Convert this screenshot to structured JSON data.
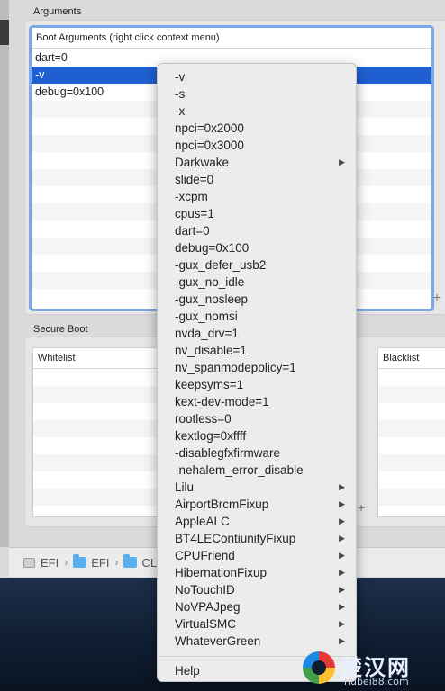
{
  "arguments": {
    "group_label": "Arguments",
    "table_header": "Boot Arguments (right click context menu)",
    "rows": [
      "dart=0",
      "-v",
      "debug=0x100"
    ],
    "selected_index": 1
  },
  "secure_boot": {
    "group_label": "Secure Boot",
    "whitelist_header": "Whitelist",
    "blacklist_header": "Blacklist"
  },
  "add_symbol": "+",
  "pathbar": {
    "crumbs": [
      "EFI",
      "EFI",
      "CL"
    ],
    "separator": "›"
  },
  "context_menu": {
    "items": [
      "-v",
      "-s",
      "-x",
      "npci=0x2000",
      "npci=0x3000",
      "Darkwake",
      "slide=0",
      "-xcpm",
      "cpus=1",
      "dart=0",
      "debug=0x100",
      "-gux_defer_usb2",
      "-gux_no_idle",
      "-gux_nosleep",
      "-gux_nomsi",
      "nvda_drv=1",
      "nv_disable=1",
      "nv_spanmodepolicy=1",
      "keepsyms=1",
      "kext-dev-mode=1",
      "rootless=0",
      "kextlog=0xffff",
      "-disablegfxfirmware",
      "-nehalem_error_disable",
      "Lilu",
      "AirportBrcmFixup",
      "AppleALC",
      "BT4LEContiunityFixup",
      "CPUFriend",
      "HibernationFixup",
      "NoTouchID",
      "NoVPAJpeg",
      "VirtualSMC",
      "WhateverGreen"
    ],
    "submenu_items": [
      "Darkwake",
      "Lilu",
      "AirportBrcmFixup",
      "AppleALC",
      "BT4LEContiunityFixup",
      "CPUFriend",
      "HibernationFixup",
      "NoTouchID",
      "NoVPAJpeg",
      "VirtualSMC",
      "WhateverGreen"
    ],
    "submenu_arrow": "▶",
    "help_label": "Help"
  },
  "watermark": {
    "text": "楚汉网",
    "url": "hubei88.com"
  },
  "colors": {
    "selection": "#1f5fd1",
    "focus_ring": "#7da7e6",
    "folder": "#5ab0ee"
  }
}
